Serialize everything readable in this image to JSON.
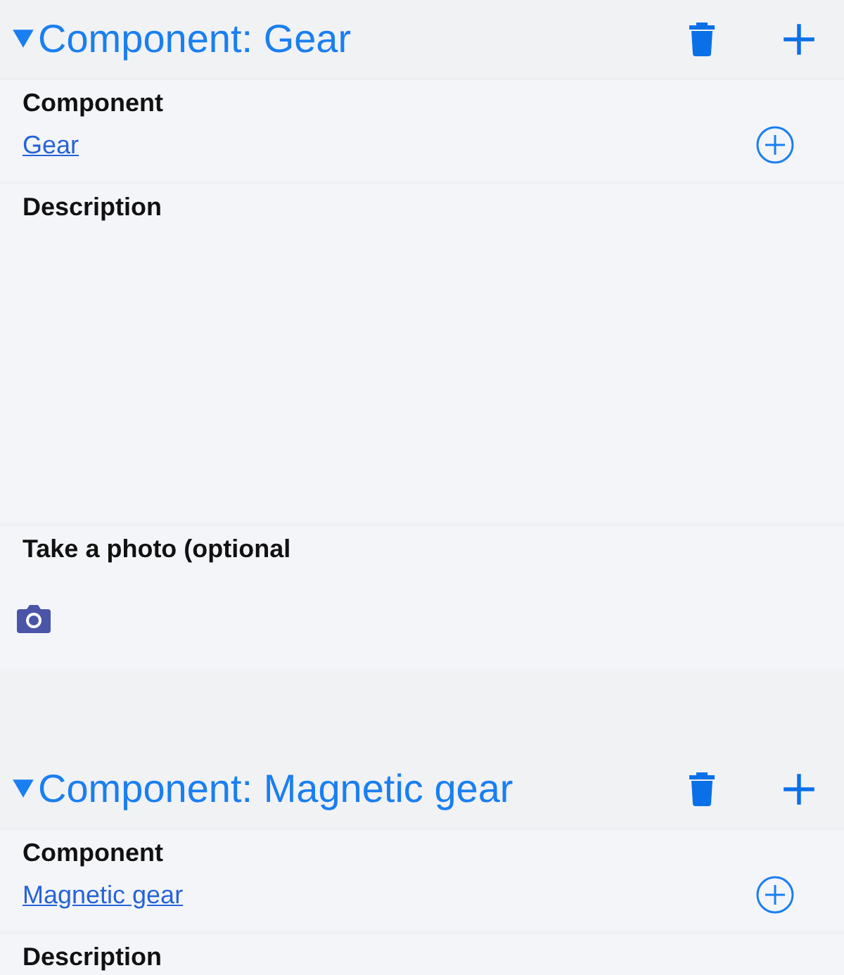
{
  "sections": [
    {
      "title": "Component: Gear",
      "expanded": true,
      "fields": [
        {
          "kind": "link",
          "label": "Component",
          "value": "Gear"
        },
        {
          "kind": "textarea",
          "label": "Description"
        },
        {
          "kind": "photo",
          "label": "Take a photo (optional"
        }
      ]
    },
    {
      "title": "Component: Magnetic gear",
      "expanded": true,
      "fields": [
        {
          "kind": "link",
          "label": "Component",
          "value": "Magnetic gear"
        },
        {
          "kind": "textarea",
          "label": "Description"
        }
      ]
    }
  ]
}
